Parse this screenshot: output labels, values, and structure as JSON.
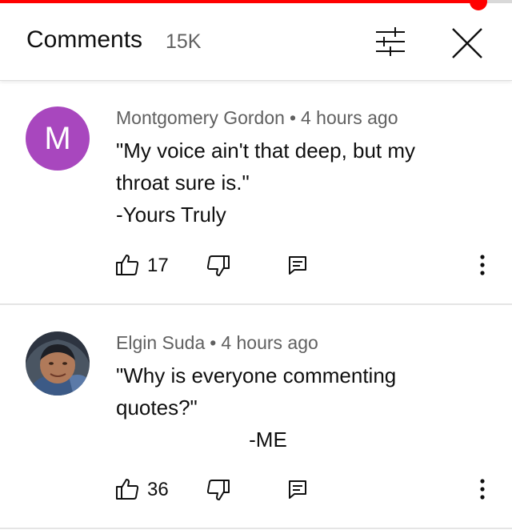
{
  "video_progress": {
    "fraction": 0.935
  },
  "header": {
    "title": "Comments",
    "count": "15K",
    "filter_icon": "filter-sliders-icon",
    "close_icon": "close-icon"
  },
  "comments": [
    {
      "author": "Montgomery Gordon",
      "separator": "•",
      "time": "4 hours ago",
      "avatar_initial": "M",
      "avatar_color": "#a847be",
      "text": "\"My voice ain't that deep, but my\nthroat sure is.\"\n-Yours Truly",
      "likes": "17"
    },
    {
      "author": "Elgin Suda",
      "separator": "•",
      "time": "4 hours ago",
      "avatar_type": "photo",
      "text": "\"Why is everyone commenting\nquotes?\"\n                       -ME",
      "likes": "36"
    }
  ],
  "icons": {
    "like": "thumbs-up-icon",
    "dislike": "thumbs-down-icon",
    "reply": "reply-icon",
    "more": "more-vert-icon"
  }
}
